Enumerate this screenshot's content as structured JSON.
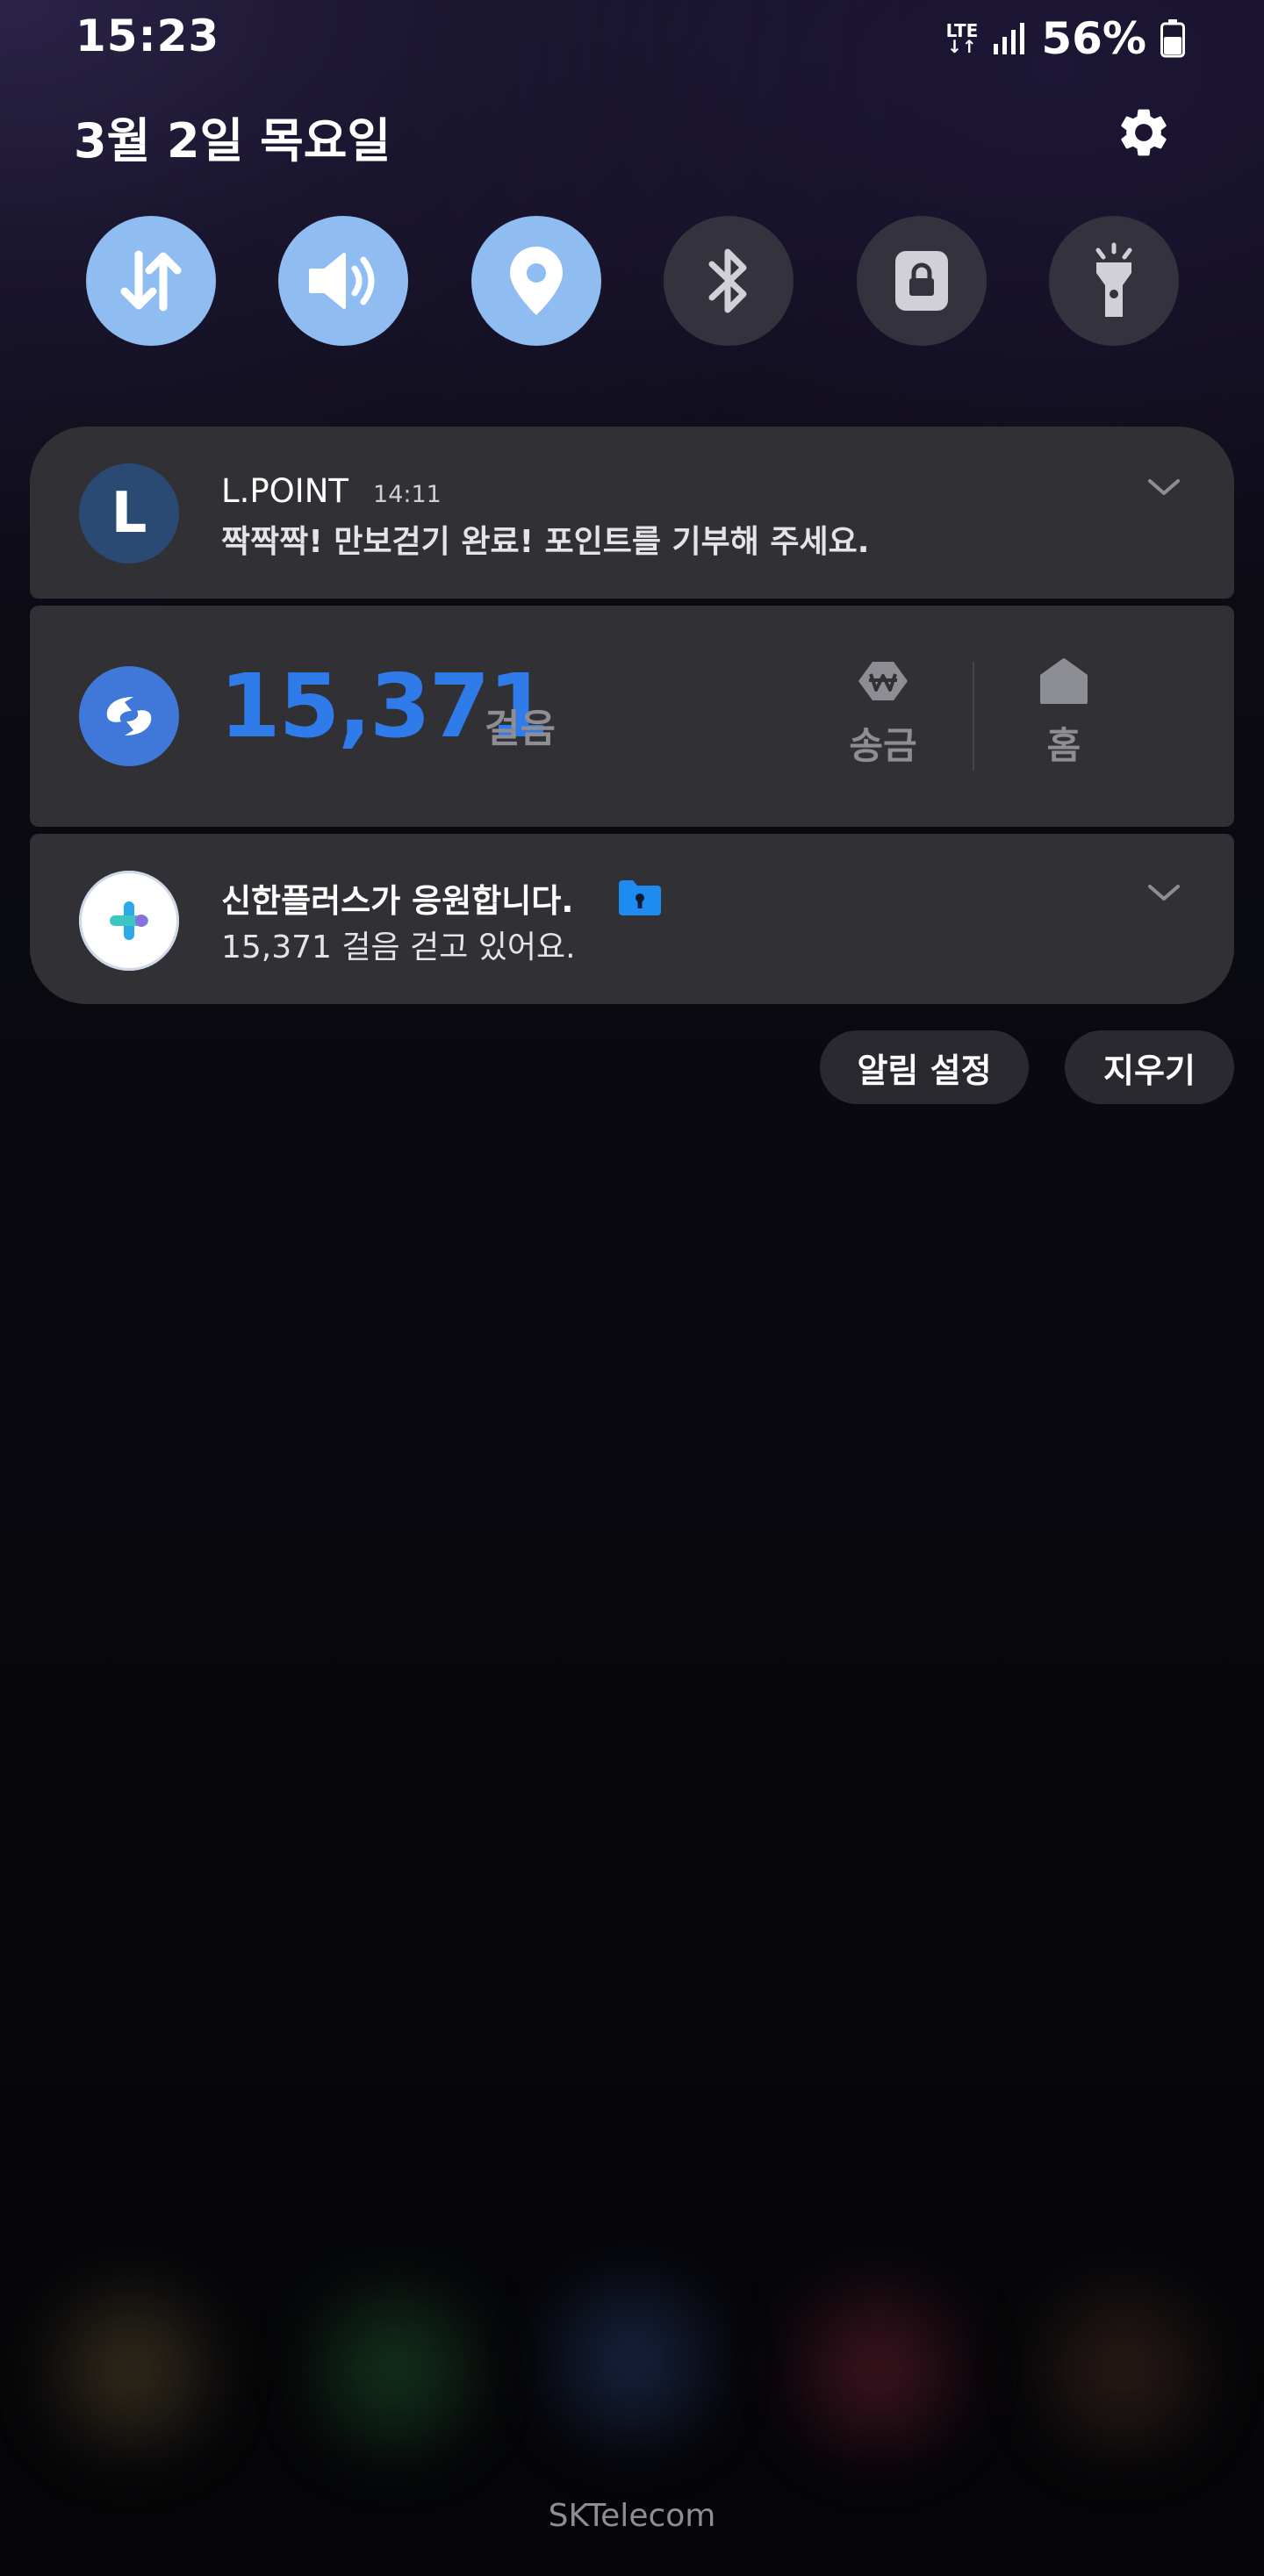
{
  "status_bar": {
    "time": "15:23",
    "network": "LTE",
    "battery_percent": "56%"
  },
  "header": {
    "date": "3월 2일 목요일",
    "settings_icon": "gear-icon"
  },
  "quick_toggles": [
    {
      "name": "mobile-data",
      "icon": "data-arrows-icon",
      "on": true
    },
    {
      "name": "sound",
      "icon": "speaker-icon",
      "on": true
    },
    {
      "name": "location",
      "icon": "location-pin-icon",
      "on": true
    },
    {
      "name": "bluetooth",
      "icon": "bluetooth-icon",
      "on": false
    },
    {
      "name": "secure-folder",
      "icon": "lock-icon",
      "on": false
    },
    {
      "name": "flashlight",
      "icon": "flashlight-icon",
      "on": false
    }
  ],
  "notifications": {
    "lpoint": {
      "icon_letter": "L",
      "app": "L.POINT",
      "time": "14:11",
      "body": "짝짝짝! 만보걷기 완료! 포인트를 기부해 주세요."
    },
    "steps_widget": {
      "steps": "15,371",
      "unit": "걸음",
      "actions": [
        {
          "label": "송금",
          "icon": "won-send-icon"
        },
        {
          "label": "홈",
          "icon": "home-icon"
        }
      ]
    },
    "shinhan": {
      "title": "신한플러스가 응원합니다.",
      "body": "15,371 걸음 걷고 있어요.",
      "badge_icon": "secure-folder-icon"
    }
  },
  "buttons": {
    "notification_settings": "알림 설정",
    "clear": "지우기"
  },
  "carrier": "SKTelecom",
  "colors": {
    "toggle_on": "#8fbcf1",
    "toggle_off": "#34333d",
    "card_bg": "#313035",
    "steps_accent": "#2f7bea"
  }
}
